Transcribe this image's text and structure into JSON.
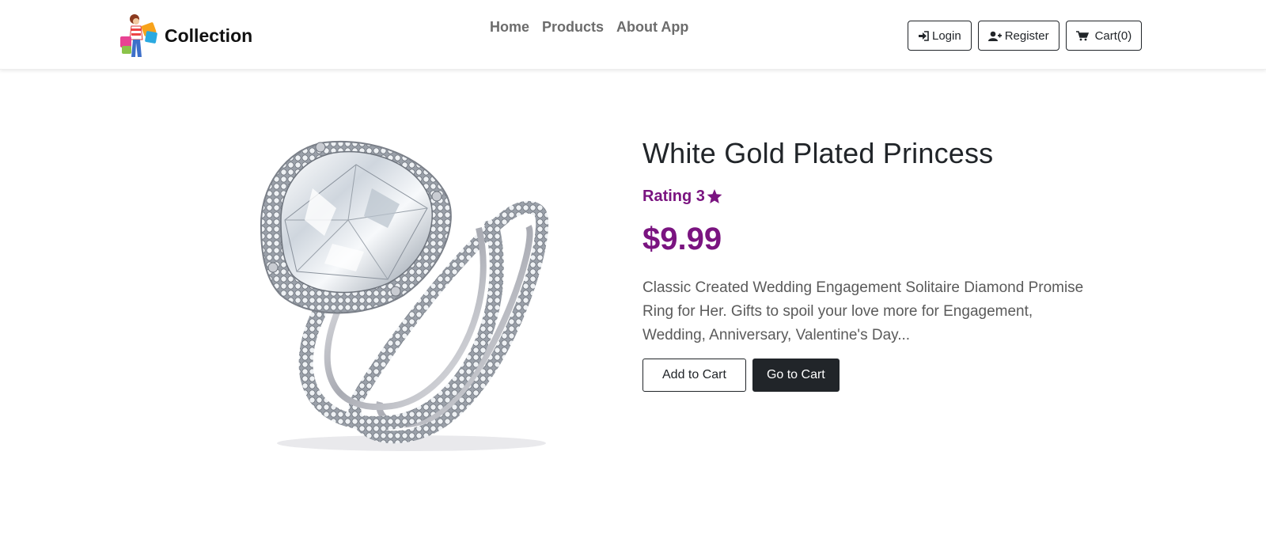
{
  "brand": {
    "name": "Collection",
    "logo_icon": "shopping-girl-icon"
  },
  "nav": {
    "links": [
      {
        "label": "Home"
      },
      {
        "label": "Products"
      },
      {
        "label": "About App"
      }
    ],
    "buttons": {
      "login": {
        "label": "Login",
        "icon": "sign-in-icon"
      },
      "register": {
        "label": "Register",
        "icon": "user-plus-icon"
      },
      "cart": {
        "label": "Cart(0)",
        "icon": "shopping-cart-icon"
      }
    }
  },
  "product": {
    "title": "White Gold Plated Princess",
    "rating_label": "Rating 3",
    "rating_icon": "star-icon",
    "price": "$9.99",
    "description": "Classic Created Wedding Engagement Solitaire Diamond Promise Ring for Her. Gifts to spoil your love more for Engagement, Wedding, Anniversary, Valentine's Day...",
    "image_icon": "diamond-ring-image",
    "add_to_cart_label": "Add to Cart",
    "go_to_cart_label": "Go to Cart"
  },
  "colors": {
    "accent": "#7a1480",
    "dark": "#212529",
    "muted": "#6c6c6c"
  }
}
